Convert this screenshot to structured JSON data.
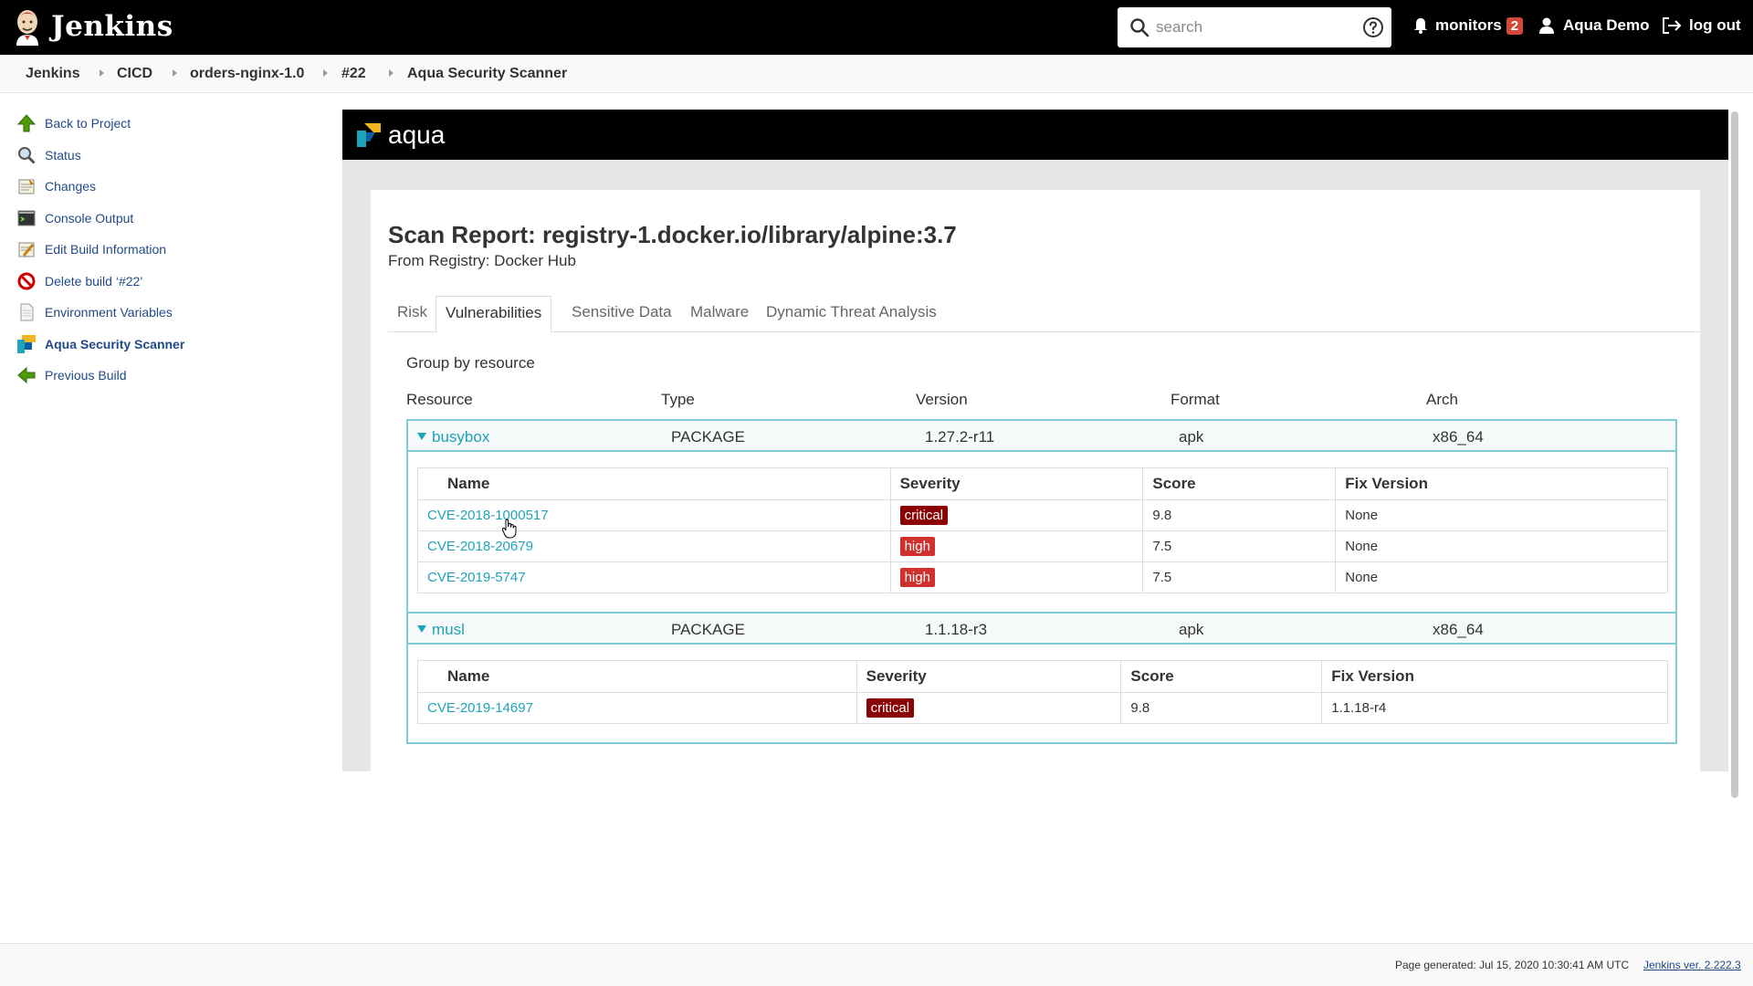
{
  "header": {
    "app_name": "Jenkins",
    "search_placeholder": "search",
    "monitors_label": "monitors",
    "monitors_count": "2",
    "user_name": "Aqua Demo",
    "logout_label": "log out"
  },
  "breadcrumb": [
    "Jenkins",
    "CICD",
    "orders-nginx-1.0",
    "#22",
    "Aqua Security Scanner"
  ],
  "sidebar": {
    "items": [
      {
        "label": "Back to Project",
        "icon": "up-arrow-icon"
      },
      {
        "label": "Status",
        "icon": "magnifier-icon"
      },
      {
        "label": "Changes",
        "icon": "notepad-icon"
      },
      {
        "label": "Console Output",
        "icon": "terminal-icon"
      },
      {
        "label": "Edit Build Information",
        "icon": "notepad-edit-icon"
      },
      {
        "label": "Delete build ‘#22’",
        "icon": "no-entry-icon"
      },
      {
        "label": "Environment Variables",
        "icon": "document-icon"
      },
      {
        "label": "Aqua Security Scanner",
        "icon": "aqua-icon"
      },
      {
        "label": "Previous Build",
        "icon": "left-arrow-icon"
      }
    ]
  },
  "aqua": {
    "brand": "aqua",
    "title": "Scan Report: registry-1.docker.io/library/alpine:3.7",
    "subtitle": "From Registry: Docker Hub",
    "tabs": [
      "Risk",
      "Vulnerabilities",
      "Sensitive Data",
      "Malware",
      "Dynamic Threat Analysis"
    ],
    "active_tab": "Vulnerabilities",
    "group_label": "Group by resource",
    "columns": [
      "Resource",
      "Type",
      "Version",
      "Format",
      "Arch"
    ],
    "vuln_columns": [
      "Name",
      "Severity",
      "Score",
      "Fix Version"
    ],
    "resources": [
      {
        "name": "busybox",
        "type": "PACKAGE",
        "version": "1.27.2-r11",
        "format": "apk",
        "arch": "x86_64",
        "vulns": [
          {
            "name": "CVE-2018-1000517",
            "severity": "critical",
            "score": "9.8",
            "fix": "None"
          },
          {
            "name": "CVE-2018-20679",
            "severity": "high",
            "score": "7.5",
            "fix": "None"
          },
          {
            "name": "CVE-2019-5747",
            "severity": "high",
            "score": "7.5",
            "fix": "None"
          }
        ]
      },
      {
        "name": "musl",
        "type": "PACKAGE",
        "version": "1.1.18-r3",
        "format": "apk",
        "arch": "x86_64",
        "vulns": [
          {
            "name": "CVE-2019-14697",
            "severity": "critical",
            "score": "9.8",
            "fix": "1.1.18-r4"
          }
        ]
      }
    ]
  },
  "footer": {
    "generated": "Page generated: Jul 15, 2020 10:30:41 AM UTC",
    "version": "Jenkins ver. 2.222.3"
  },
  "colors": {
    "accent": "#1fa3b8",
    "critical": "#8b0000",
    "high": "#d0302e",
    "link": "#204a87"
  }
}
